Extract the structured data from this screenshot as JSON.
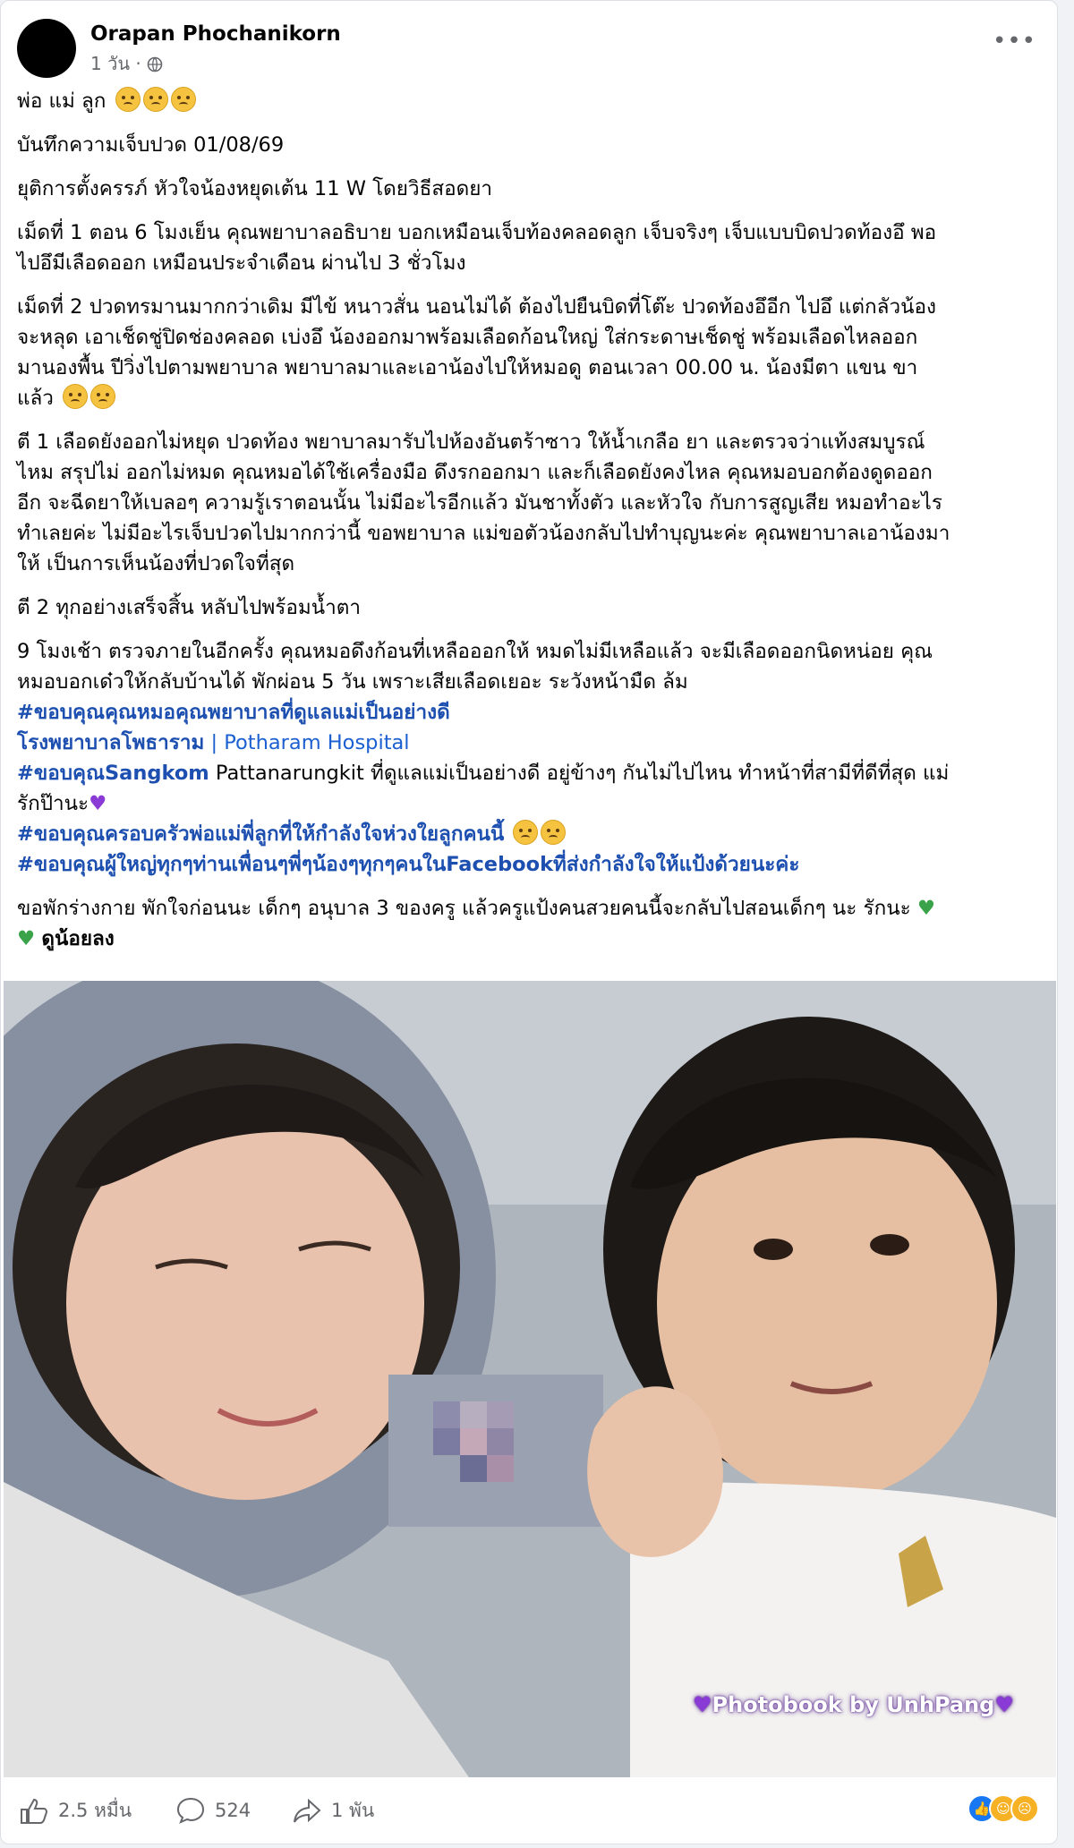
{
  "post": {
    "author": "Orapan Phochanikorn",
    "time": "1 วัน ·",
    "more": "•••",
    "paragraphs": {
      "p1": "พ่อ แม่ ลูก",
      "p2": "บันทึกความเจ็บปวด 01/08/69",
      "p3": "ยุติการตั้งครรภ์ หัวใจน้องหยุดเต้น  11 W โดยวิธีสอดยา",
      "p4a": "เม็ดที่ 1 ตอน 6 โมงเย็น คุณพยาบาลอธิบาย บอกเหมือนเจ็บท้องคลอดลูก เจ็บจริงๆ เจ็บแบบบิดปวดท้องอึ พอ",
      "p4b": "ไปอึมีเลือดออก เหมือนประจำเดือน ผ่านไป 3 ชั่วโมง",
      "p5a": "เม็ดที่ 2 ปวดทรมานมากกว่าเดิม มีไข้ หนาวสั่น นอนไม่ได้ ต้องไปยืนบิดที่โต๊ะ ปวดท้องอึอีก ไปอึ แต่กลัวน้อง",
      "p5b": "จะหลุด เอาเช็ดชู่ปิดช่องคลอด เบ่งอึ น้องออกมาพร้อมเลือดก้อนใหญ่ ใส่กระดาษเช็ดชู่ พร้อมเลือดไหลออก",
      "p5c": "มานองพื้น ปีวิ่งไปตามพยาบาล พยาบาลมาและเอาน้องไปให้หมอดู ตอนเวลา 00.00 น. น้องมีตา แขน ขา",
      "p5d": "แล้ว",
      "p6a": "ตี 1 เลือดยังออกไม่หยุด ปวดท้อง พยาบาลมารับไปห้องอันตร้าซาว ให้น้ำเกลือ ยา และตรวจว่าแท้งสมบูรณ์",
      "p6b": "ไหม สรุปไม่ ออกไม่หมด คุณหมอได้ใช้เครื่องมือ ดึงรกออกมา และก็เลือดยังคงไหล คุณหมอบอกต้องดูดออก",
      "p6c": "อีก จะฉีดยาให้เบลอๆ ความรู้เราตอนนั้น ไม่มีอะไรอีกแล้ว มันชาทั้งตัว และหัวใจ กับการสูญเสีย หมอทำอะไร",
      "p6d": "ทำเลยค่ะ ไม่มีอะไรเจ็บปวดไปมากกว่านี้ ขอพยาบาล แม่ขอตัวน้องกลับไปทำบุญนะค่ะ คุณพยาบาลเอาน้องมา",
      "p6e": "ให้ เป็นการเห็นน้องที่ปวดใจที่สุด",
      "p7": "ตี 2 ทุกอย่างเสร็จสิ้น หลับไปพร้อมน้ำตา",
      "p8a": "9 โมงเช้า ตรวจภายในอีกครั้ง คุณหมอดึงก้อนที่เหลือออกให้ หมดไม่มีเหลือแล้ว จะมีเลือดออกนิดหน่อย คุณ",
      "p8b": "หมอบอกเด๋วให้กลับบ้านได้ พักผ่อน 5 วัน เพราะเสียเลือดเยอะ ระวังหน้ามืด ล้ม",
      "tag1": "#ขอบคุณคุณหมอคุณพยาบาลที่ดูแลแม่เป็นอย่างดี",
      "hospital_th": "โรงพยาบาลโพธาราม",
      "hospital_sep": " | ",
      "hospital_en": "Potharam Hospital",
      "tag2_link": "#ขอบคุณSangkom",
      "tag2_text": " Pattanarungkit ที่ดูแลแม่เป็นอย่างดี อยู่ข้างๆ กันไม่ไปไหน ทำหน้าที่สามีที่ดีที่สุด แม่",
      "tag2_cont": "รักป๊านะ",
      "tag3": "#ขอบคุณครอบครัวพ่อแม่พี่ลูกที่ให้กำลังใจห่วงใยลูกคนนี้",
      "tag4": "#ขอบคุณผู้ใหญ่ทุกๆท่านเพื่อนๆพี่ๆน้องๆทุกๆคนในFacebookที่ส่งกำลังใจให้แป้งด้วยนะค่ะ",
      "p9": "ขอพักร่างกาย พักใจก่อนนะ เด็กๆ อนุบาล 3 ของครู แล้วครูแป้งคนสวยคนนี้จะกลับไปสอนเด็กๆ นะ รักนะ",
      "p10": "ดูน้อยลง"
    },
    "photo_watermark": "Photobook by UnhPang",
    "stats": {
      "likes": "2.5 หมื่น",
      "comments": "524",
      "shares": "1 พัน"
    },
    "colors": {
      "hashtag": "#1c4fb0",
      "link": "#1b5fd1",
      "secondary_text": "#65676b"
    }
  }
}
